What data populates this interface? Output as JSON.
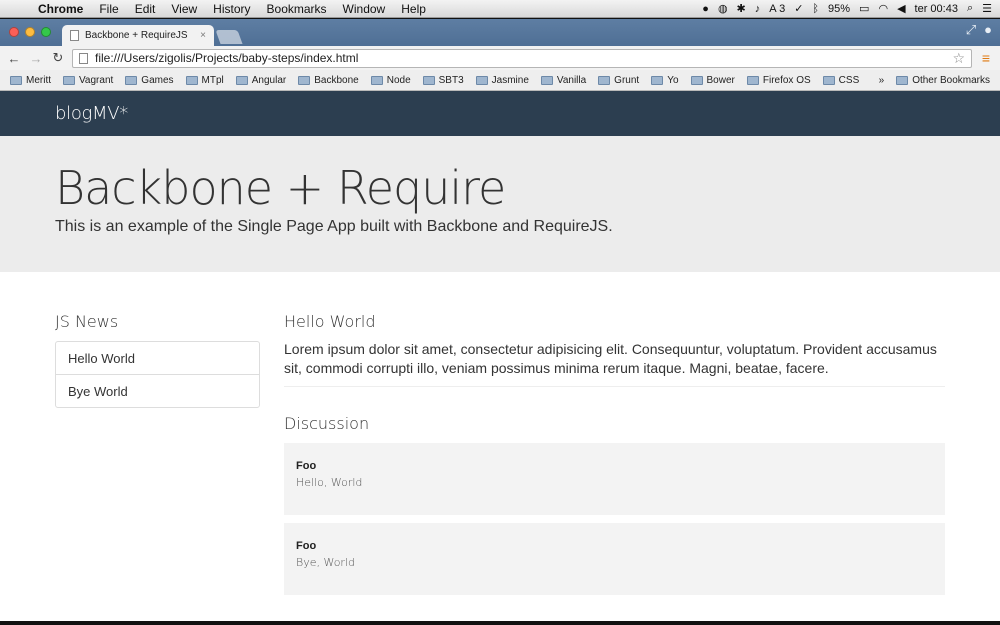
{
  "menubar": {
    "apple": "",
    "items": [
      "Chrome",
      "File",
      "Edit",
      "View",
      "History",
      "Bookmarks",
      "Window",
      "Help"
    ],
    "status": {
      "adobe_count": "3",
      "battery": "95%",
      "clock": "ter 00:43"
    }
  },
  "tab": {
    "title": "Backbone + RequireJS",
    "close": "×"
  },
  "toolbar": {
    "back": "←",
    "forward": "→",
    "reload": "↻",
    "url": "file:///Users/zigolis/Projects/baby-steps/index.html",
    "star": "☆",
    "menu": "≡"
  },
  "bookmarks": {
    "items": [
      "Meritt",
      "Vagrant",
      "Games",
      "MTpl",
      "Angular",
      "Backbone",
      "Node",
      "SBT3",
      "Jasmine",
      "Vanilla",
      "Grunt",
      "Yo",
      "Bower",
      "Firefox OS",
      "CSS"
    ],
    "overflow": "»",
    "other": "Other Bookmarks"
  },
  "site": {
    "brand": "blogMV*",
    "hero_title": "Backbone + Require",
    "hero_text": "This is an example of the Single Page App built with Backbone and RequireJS.",
    "sidebar_title": "JS News",
    "news": [
      "Hello World",
      "Bye World"
    ],
    "article_title": "Hello World",
    "article_body": "Lorem ipsum dolor sit amet, consectetur adipisicing elit. Consequuntur, voluptatum. Provident accusamus sit, commodi corrupti illo, veniam possimus minima rerum itaque. Magni, beatae, facere.",
    "discussion_title": "Discussion",
    "comments": [
      {
        "author": "Foo",
        "text": "Hello, World"
      },
      {
        "author": "Foo",
        "text": "Bye, World"
      }
    ]
  }
}
